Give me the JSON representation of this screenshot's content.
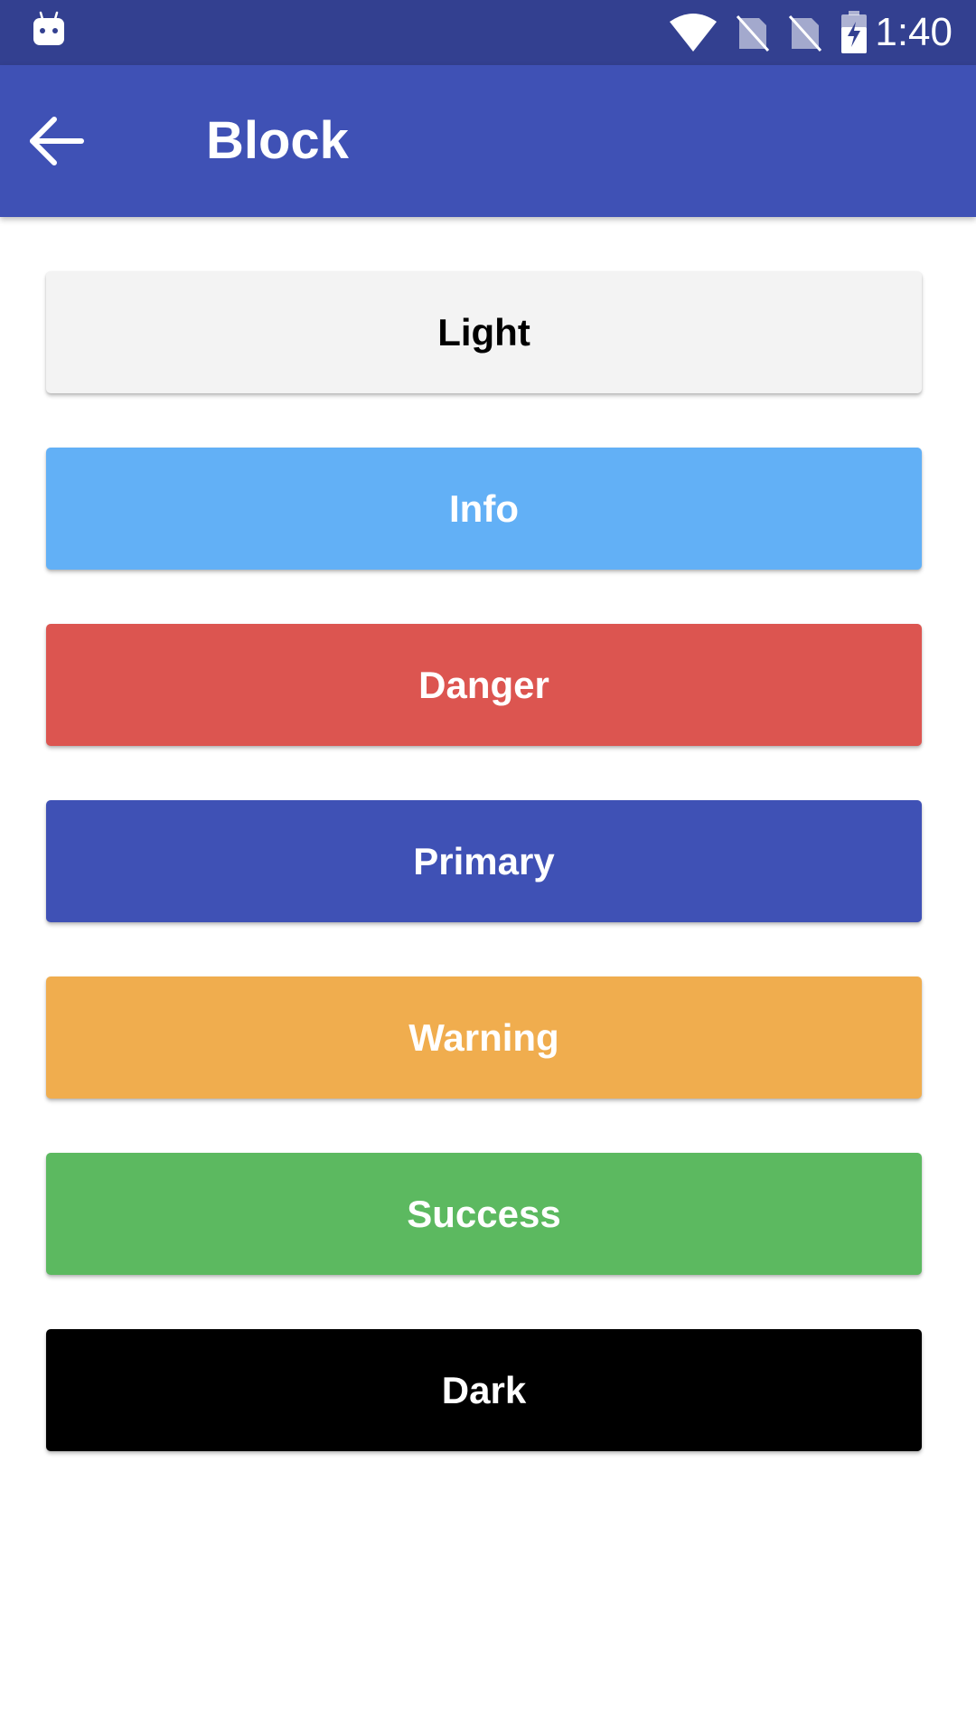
{
  "status_bar": {
    "time": "1:40",
    "icons": [
      "android-icon",
      "wifi-icon",
      "no-sim-icon",
      "no-sim-icon",
      "battery-charging-icon"
    ]
  },
  "app_bar": {
    "title": "Block",
    "back_icon": "arrow-back-icon",
    "background": "#3f51b5"
  },
  "buttons": [
    {
      "label": "Light",
      "color": "#f3f3f3"
    },
    {
      "label": "Info",
      "color": "#62b0f6"
    },
    {
      "label": "Danger",
      "color": "#dc5550"
    },
    {
      "label": "Primary",
      "color": "#3f51b5"
    },
    {
      "label": "Warning",
      "color": "#f0ad4e"
    },
    {
      "label": "Success",
      "color": "#5cb960"
    },
    {
      "label": "Dark",
      "color": "#000000"
    }
  ]
}
